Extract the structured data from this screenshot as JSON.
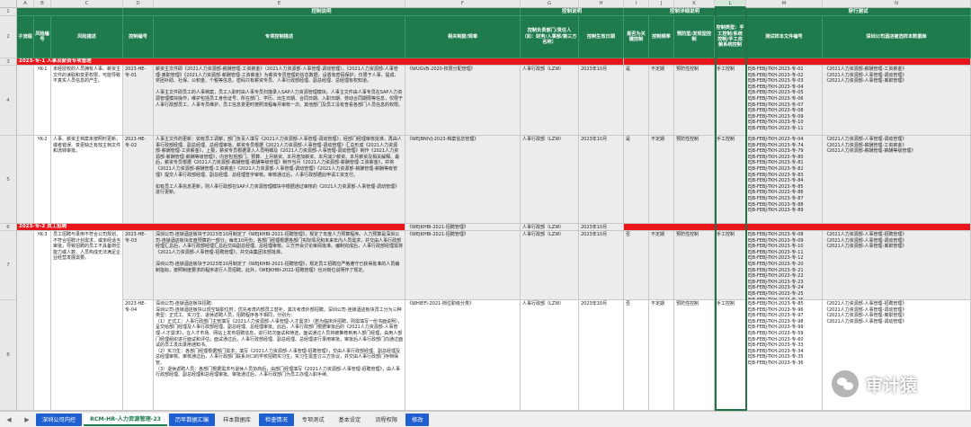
{
  "columns": [
    {
      "letter": "A"
    },
    {
      "letter": "B"
    },
    {
      "letter": "C"
    },
    {
      "letter": "D"
    },
    {
      "letter": "E"
    },
    {
      "letter": "F"
    },
    {
      "letter": "G"
    },
    {
      "letter": "H"
    },
    {
      "letter": "I"
    },
    {
      "letter": "J"
    },
    {
      "letter": "K"
    },
    {
      "letter": "L"
    },
    {
      "letter": "M"
    },
    {
      "letter": "N"
    }
  ],
  "rows": [
    "1",
    "2",
    "3",
    "4",
    "5",
    "6",
    "7",
    "8"
  ],
  "header": {
    "control_desc": "控制说明",
    "control_desc2": "控制说明",
    "control_detail": "控制详细说明",
    "walkthrough": "穿行测试",
    "sub_process": "子流程",
    "risk_no": "风险编号",
    "risk_desc": "风险描述",
    "control_no": "控制编号",
    "control_activity": "专项控制描述",
    "policy": "相关制度/规章",
    "dept": "控制负责部门/责任人（如：财务/人事部/第三方名称）",
    "date": "控制生效日期",
    "key_control": "是否为关键控制",
    "freq": "控制频率",
    "type": "预防型/发现型控制",
    "manual": "控制类型：手工控制/系统控制/手工依赖系统控制",
    "test_doc": "测试样本文件编号",
    "sample_name": "深圳公司酒店被选样本数据库"
  },
  "sections": {
    "s1": "2023-专-1 人事及薪资专项管理",
    "s2": "2023-专-2 员工招聘"
  },
  "records": [
    {
      "risk_no": "YK-1",
      "risk_desc": "未经授权的人员拥有人事、薪资主文件的读取和变更权限，可能导致不真实人员信息的产生。",
      "control_no": "2023-HE-专-01",
      "activity": "薪资主文件即《2021人力资源部-薪酬管理-工资薪金》（2021人力资源部-人事管理-调动管理），《2021人力资源部-人事管理-离职管理》《2021人力资源部-薪酬管理-工资薪金》为薪资专员管理的信息数据，设置有密码保护，仅限于人事、提成、奖团补助、社保、公积金、个税等信息。密码只有薪资专员、人事行政部经理、副总经理、总经理有权知道。\n\n人事主文件即员工的人事档案，员工入职时由人事专员扫描录入SAP人力资源管理模块。人事主文件由人事专员在SAP人力资源管理模块操作，维护包括员工身份证号、所在部门、学历、出生日期、合同日期、入职日期、劳动合同期限等信息，仅限于人事行政部员工、人事专员维护，员工信息变更时按照流程每月审核一次。其他部门及员工没有查看各部门人员信息的权限。",
      "policy": "《WUGVB-2020-权限分配管理》",
      "dept": "人事行政部（LZW）",
      "date": "2023年10月",
      "key": "是",
      "freq": "不定期",
      "type": "预防性控制",
      "manual": "手工控制",
      "test_docs": "EJB-FEBJ-TKH-2023-专-01\nEJB-FEBJ-TKH-2023-专-02\nEJB-FEBJ-TKH-2023-专-03\nEJB-FEBJ-TKH-2023-专-04\nEJB-FEBJ-TKH-2023-专-05\nEJB-FEBJ-TKH-2023-专-06\nEJB-FEBJ-TKH-2023-专-07\nEJB-FEBJ-TKH-2023-专-08\nEJB-FEBJ-TKH-2023-专-09\nEJB-FEBJ-TKH-2023-专-10\nEJB-FEBJ-TKH-2023-专-11",
      "samples": "《2021人力资源部-薪酬管理-工资薪金》\n《2021人力资源部-人事管理-调动管理》\n《2021人力资源部-人事管理-离职管理》"
    },
    {
      "risk_no": "YK-2",
      "risk_desc": "人事、薪资主档案未按照时更新，或者错误、变更缺乏有效主档文件和流转审批。",
      "control_no": "2023-HE-专-02",
      "activity": "人事主文件的更新：如有员工调薪，部门负责人填写《2021人力资源部-人事管理-调动管理》，经部门经理审核批准，再由人事行政部经理、副总经理、总经理审批。薪资专员根据《2021人力资源部-人事管理-调动管理》汇总形成《2021人力资源部-薪酬管理-工资薪金》，上报，薪资专员根据录入人员明细及《2021人力资源部-人事管理-调动管理》制作《2021人力资源部-薪酬管理-薪酬等级管理》，内容包括部门、预算、上月薪资、本月增加薪资、本月减少薪资、本月薪资及相关解释。最后，薪资专员根据《2021人力资源部-薪酬管理-薪酬等级管理》制作当月《2021人力资源部-薪酬管理-工资薪金》，并将《2021人力资源部-薪酬管理-工资薪金》《2021人力资源部-人事管理-调动管理》《2021人力资源部-薪酬管理-薪酬等级管理》提交人事行政部经理、副总经理、总经理签字审核。审核通过后，人事行政部据此申请工资支付。\n\n如有员工人事信息更新，则人事行政部在SAP人力资源管理模块中根据通过审核的《2021人力资源部-人事管理-调动管理》进行更新。",
      "policy": "《WEJBNIVJ-2023-档案信息管理》",
      "dept": "人事行政部（LZW）",
      "date": "2023年10月",
      "key": "是",
      "freq": "不定期",
      "type": "预防性控制",
      "manual": "手工控制",
      "test_docs": "EJB-FEBJ-TKH-2023-专-04\nEJB-FEBJ-TKH-2023-专-74\nEJB-FEBJ-TKH-2023-专-79\nEJB-FEBJ-TKH-2023-专-80\nEJB-FEBJ-TKH-2023-专-81\nEJB-FEBJ-TKH-2023-专-82\nEJB-FEBJ-TKH-2023-专-83\nEJB-FEBJ-TKH-2023-专-84\nEJB-FEBJ-TKH-2023-专-85\nEJB-FEBJ-TKH-2023-专-86\nEJB-FEBJ-TKH-2023-专-87\nEJB-FEBJ-TKH-2023-专-88\nEJB-FEBJ-TKH-2023-专-89",
      "samples": "《2021人力资源部-人事管理-调动管理》\n《2021人力资源部-薪酬管理-工资薪金》\n《2021人力资源部-薪酬管理-薪酬等级管理》"
    },
    {
      "policy_s2": "《WEJKHBI-2021-招聘管理》",
      "dept_s2": "人事行政部（LZW）",
      "date_s2": "2023年10月",
      "risk_no": "YK-3",
      "risk_desc": "员工招聘与录用不符合公司规划，不符合招聘计划需求，或未经适当审批，导致招聘的员工不具备岗位能力或人数、人员构成无法满足企业经营发展需要。",
      "control_no": "2023-HE-专-03",
      "activity": "深圳公司-连锁酒店板块于2023年10月制定了《WEJKHBI-2021-招聘管理》，规定了年度人力预算程序。人力预算是深圳公司-连锁酒店板块年度预算的一部分。每年10月份，各部门经理根据各部门实际情况和未来年内人员需求，并交由人事行政部经理汇总后，人事行政部经理汇总后交由副总经理、总经理审核。三方开会讨论审阅批准。编制完成后，人事行政部经理需将《2021人力资源部-人事管理-招聘管理》，并交由集团本部批准。\n\n深圳公司-连锁酒店板块于2023年10月制定了《WEJKHBI-2021-招聘管理》，规定员工招聘应严格遵守已获得批准的人员编制指标，按照制度要求的程序进行人员招聘。此外，《WEJKHBI-2022-招聘管理》也对岗位说明作了规定。",
      "policy": "《WEJKHBI-2021-招聘管理》",
      "dept": "人事行政部（LZW）",
      "date": "2023年10月",
      "key": "否",
      "freq": "不定期",
      "type": "预防性控制",
      "manual": "手工控制",
      "test_docs": "EJB-FEBJ-TKH-2023-专-08\nEJB-FEBJ-TKH-2023-专-09\nEJB-FEBJ-TKH-2023-专-10\nEJB-FEBJ-TKH-2023-专-11\nEJB-FEBJ-TKH-2023-专-12\nEJB-FEBJ-TKH-2023-专-20\nEJB-FEBJ-TKH-2023-专-21\nEJB-FEBJ-TKH-2023-专-22\nEJB-FEBJ-TKH-2023-专-23\nEJB-FEBJ-TKH-2023-专-24\nEJB-FEBJ-TKH-2023-专-25\nEJB-FEBJ-TKH-2023-专-26",
      "samples": "《2021人力资源部-人事管理-招聘管理》\n《2021人力资源部-人事管理-调动管理》\n《2021人力资源部-人事管理-离职管理》"
    },
    {
      "risk_no": "",
      "risk_desc": "",
      "control_no": "2023-HE-专-04",
      "activity": "深圳公司-连锁酒店板块招聘：\n深圳公司-连锁酒店板块以现空缺职位时，优先考虑内部员工替补，其次考虑外部招聘。深圳公司-连锁酒店板块员工分为三种类型：正式工、实习生、退休返聘人员，招聘程序各不相同，分别为：\n（1）正式工：人事行政部门主管填写《2021人力资源部-人事管理-人才需求》（若为临床外招聘，则需填写一份书面说明），呈交给部门经理及人事行政部经理、副总经理、总经理审批。此后，人事行政部门根据审批后的《2021人力资源部-人事管理-人才需求》，在人才市场、网站上发布招聘信息，进行初次面试和筛选，面试通过人员将被推荐到用人部门经理，由用人部门经理组织进行面试和评估；面试通过后，人事行政部经理、副总经理、总经理进行录用审批，审批后人事行政部门向通过面试的员工发出录用通知书。\n（2）实习生：各部门经理根据部门需求，填写《2021人力资源部-人事管理-招聘管理》，交由人事行政部经理、副总经理及总经理审核。审核通过后，人事行政部门联系对口的学校招聘实习生，实习生需签订三方协议，并交由人事行政部门存档保管。\n（3）退休返聘人员：各部门根据需求与退休人员协商后，由部门经理填写《2021人力资源部-人事管理-招聘管理》，由人事行政部经理、副总经理和总经理审批。审批通过后，人事行政部门为员工办理入职手续。",
      "policy": "《WHIEFI-2021-岗位职级分类》",
      "dept": "人事行政部（LZW）",
      "date": "2023年10月",
      "key": "否",
      "freq": "不定期",
      "type": "预防性控制",
      "manual": "手工控制",
      "test_docs": "EJB-FEBJ-TKH-2023-专-85\nEJB-FEBJ-TKH-2023-专-96\nEJB-FEBJ-TKH-2023-专-97\nEJB-FEBJ-TKH-2023-专-98\nEJB-FEBJ-TKH-2023-专-99\nEJB-FEBJ-TKH-2023-专-59\nEJB-FEBJ-TKH-2023-专-60\nEJB-FEBJ-TKH-2023-专-33\nEJB-FEBJ-TKH-2023-专-34\nEJB-FEBJ-TKH-2023-专-35\nEJB-FEBJ-TKH-2023-专-36",
      "samples": "《2021人力资源部-人事管理-招聘管理》\n《2021人力资源部-人事管理-调动管理》\n《2021人力资源部-人事管理-离职管理》\n《2021人力资源部-人事管理-调动管理》"
    }
  ],
  "tabs": [
    {
      "label": "深圳公司内控"
    },
    {
      "label": "RCM-HR-人力资源管理-23"
    },
    {
      "label": "历年数据汇编"
    },
    {
      "label": "样本数据库"
    },
    {
      "label": "检查情况"
    },
    {
      "label": "专项测试"
    },
    {
      "label": "基本设定"
    },
    {
      "label": "流程权限"
    },
    {
      "label": "修改"
    }
  ],
  "nav": {
    "prev": "◀",
    "next": "▶"
  },
  "watermark": {
    "text": "审计猿"
  }
}
